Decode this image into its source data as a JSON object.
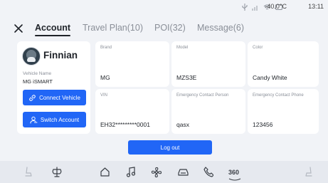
{
  "status_bar": {
    "icons": [
      "usb-icon",
      "signal-icon",
      "wifi-icon",
      "message-icon"
    ],
    "temperature": "-40.0°C",
    "time": "13:11"
  },
  "tabs": [
    {
      "label": "Account",
      "active": true
    },
    {
      "label": "Travel Plan(10)",
      "active": false
    },
    {
      "label": "POI(32)",
      "active": false
    },
    {
      "label": "Message(6)",
      "active": false
    }
  ],
  "profile": {
    "name": "Finnian",
    "vehicle_label": "Vehicle Name",
    "vehicle_name": "MG iSMART",
    "connect_label": "Connect Vehicle",
    "switch_label": "Switch Account"
  },
  "info": {
    "brand": {
      "label": "Brand",
      "value": "MG"
    },
    "model": {
      "label": "Model",
      "value": "MZS3E"
    },
    "color": {
      "label": "Color",
      "value": "Candy White"
    },
    "vin": {
      "label": "VIN",
      "value": "EH32*********0001"
    },
    "contact_person": {
      "label": "Emergency Contact Person",
      "value": "qasx"
    },
    "contact_phone": {
      "label": "Emergency Contact Phone",
      "value": "123456"
    }
  },
  "logout_label": "Log out",
  "dock": {
    "items": [
      "seat-heat-icon",
      "fan-icon",
      "home-icon",
      "music-icon",
      "ac-fan-icon",
      "car-icon",
      "phone-icon",
      "360-view-icon",
      "seat-heat-right-icon"
    ],
    "view_360_label": "360"
  },
  "colors": {
    "accent": "#2166f6",
    "background": "#f1f3f7",
    "card": "#ffffff"
  }
}
